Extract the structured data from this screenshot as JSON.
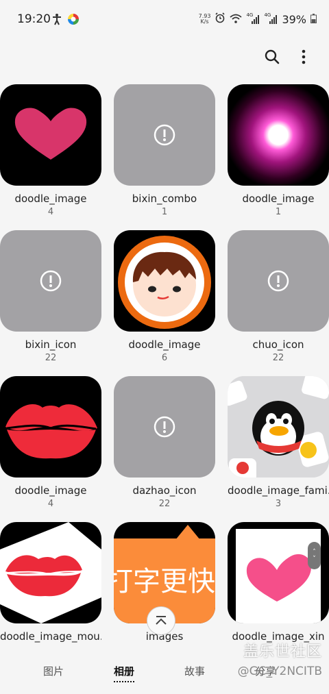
{
  "status_bar": {
    "time": "19:20",
    "net_speed_value": "7.93",
    "net_speed_unit": "K/s",
    "signal_label_1": "4G",
    "signal_label_2": "4G",
    "battery": "39%"
  },
  "toolbar": {
    "search_icon": "search-icon",
    "more_icon": "more-vert-icon"
  },
  "albums": [
    {
      "label": "doodle_image",
      "count": "4"
    },
    {
      "label": "bixin_combo",
      "count": "1"
    },
    {
      "label": "doodle_image",
      "count": "1"
    },
    {
      "label": "bixin_icon",
      "count": "22"
    },
    {
      "label": "doodle_image",
      "count": "6"
    },
    {
      "label": "chuo_icon",
      "count": "22"
    },
    {
      "label": "doodle_image",
      "count": "4"
    },
    {
      "label": "dazhao_icon",
      "count": "22"
    },
    {
      "label": "doodle_image_fami...",
      "count": "3"
    },
    {
      "label": "doodle_image_mou...",
      "count": ""
    },
    {
      "label": "images",
      "count": ""
    },
    {
      "label": "doodle_image_xin",
      "count": ""
    }
  ],
  "thumbnail_text": {
    "images_banner": "打字更快"
  },
  "bottom_nav": {
    "tab1": "图片",
    "tab2": "相册",
    "tab3": "故事",
    "tab4": "分享"
  },
  "watermark": {
    "line1": "盖乐世社区",
    "line2": "@GC_Y2NCITB"
  }
}
